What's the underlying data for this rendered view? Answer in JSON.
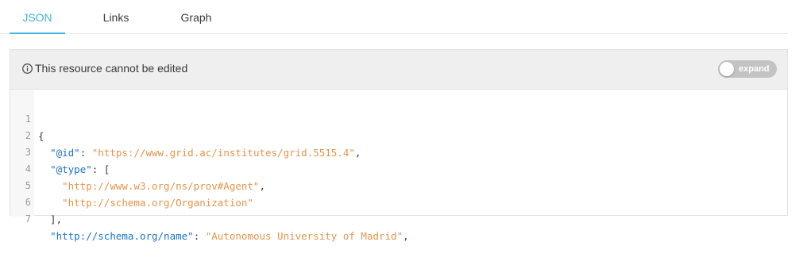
{
  "tabs": [
    {
      "label": "JSON",
      "active": true
    },
    {
      "label": "Links",
      "active": false
    },
    {
      "label": "Graph",
      "active": false
    }
  ],
  "notice": {
    "icon": "info-circle-icon",
    "text": "This resource cannot be edited"
  },
  "toggle": {
    "label": "expand",
    "checked": false
  },
  "editor": {
    "lines": [
      {
        "n": "1",
        "pre": "{",
        "key": "",
        "mid": "",
        "val": "",
        "post": ""
      },
      {
        "n": "2",
        "pre": "  ",
        "key": "\"@id\"",
        "mid": ": ",
        "val": "\"https://www.grid.ac/institutes/grid.5515.4\"",
        "post": ","
      },
      {
        "n": "3",
        "pre": "  ",
        "key": "\"@type\"",
        "mid": ": [",
        "val": "",
        "post": ""
      },
      {
        "n": "4",
        "pre": "    ",
        "key": "",
        "mid": "",
        "val": "\"http://www.w3.org/ns/prov#Agent\"",
        "post": ","
      },
      {
        "n": "5",
        "pre": "    ",
        "key": "",
        "mid": "",
        "val": "\"http://schema.org/Organization\"",
        "post": ""
      },
      {
        "n": "6",
        "pre": "  ],",
        "key": "",
        "mid": "",
        "val": "",
        "post": ""
      },
      {
        "n": "7",
        "pre": "  ",
        "key": "\"http://schema.org/name\"",
        "mid": ": ",
        "val": "\"Autonomous University of Madrid\"",
        "post": ","
      }
    ]
  },
  "colors": {
    "accent": "#40b4e0",
    "json_key": "#1a73c8",
    "json_string": "#e5944a"
  }
}
